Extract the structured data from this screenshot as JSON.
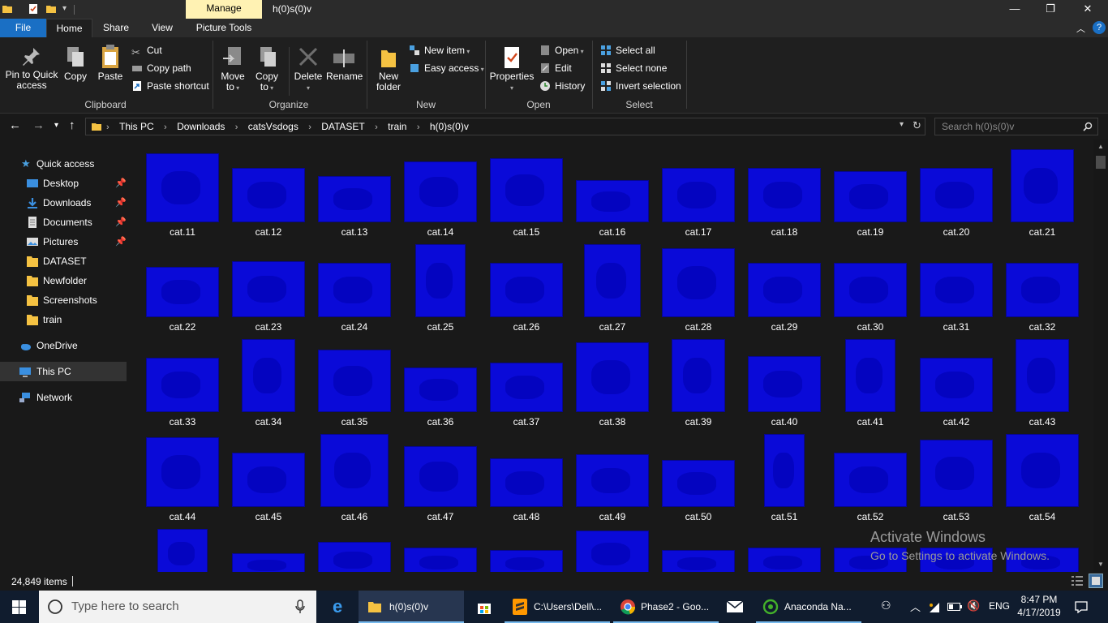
{
  "window": {
    "title": "h(0)s(0)v",
    "manage_label": "Manage",
    "minimize": "—",
    "restore": "❐",
    "close": "✕"
  },
  "ribbon_tabs": [
    "File",
    "Home",
    "Share",
    "View",
    "Picture Tools"
  ],
  "ribbon": {
    "clipboard": {
      "pin_line1": "Pin to Quick",
      "pin_line2": "access",
      "copy": "Copy",
      "paste": "Paste",
      "cut": "Cut",
      "copy_path": "Copy path",
      "paste_shortcut": "Paste shortcut",
      "label": "Clipboard"
    },
    "organize": {
      "move_to_1": "Move",
      "move_to_2": "to",
      "copy_to_1": "Copy",
      "copy_to_2": "to",
      "delete": "Delete",
      "rename": "Rename",
      "label": "Organize"
    },
    "new": {
      "new_folder_1": "New",
      "new_folder_2": "folder",
      "new_item": "New item",
      "easy_access": "Easy access",
      "label": "New"
    },
    "open": {
      "properties": "Properties",
      "open": "Open",
      "edit": "Edit",
      "history": "History",
      "label": "Open"
    },
    "select": {
      "select_all": "Select all",
      "select_none": "Select none",
      "invert_selection": "Invert selection",
      "label": "Select"
    }
  },
  "address": {
    "breadcrumbs": [
      "This PC",
      "Downloads",
      "catsVsdogs",
      "DATASET",
      "train",
      "h(0)s(0)v"
    ],
    "search_placeholder": "Search h(0)s(0)v"
  },
  "navpane": {
    "quick_access": "Quick access",
    "items": [
      "Desktop",
      "Downloads",
      "Documents",
      "Pictures",
      "DATASET",
      "Newfolder",
      "Screenshots",
      "train"
    ],
    "onedrive": "OneDrive",
    "this_pc": "This PC",
    "network": "Network"
  },
  "files": [
    "cat.11",
    "cat.12",
    "cat.13",
    "cat.14",
    "cat.15",
    "cat.16",
    "cat.17",
    "cat.18",
    "cat.19",
    "cat.20",
    "cat.21",
    "cat.22",
    "cat.23",
    "cat.24",
    "cat.25",
    "cat.26",
    "cat.27",
    "cat.28",
    "cat.29",
    "cat.30",
    "cat.31",
    "cat.32",
    "cat.33",
    "cat.34",
    "cat.35",
    "cat.36",
    "cat.37",
    "cat.38",
    "cat.39",
    "cat.40",
    "cat.41",
    "cat.42",
    "cat.43",
    "cat.44",
    "cat.45",
    "cat.46",
    "cat.47",
    "cat.48",
    "cat.49",
    "cat.50",
    "cat.51",
    "cat.52",
    "cat.53",
    "cat.54"
  ],
  "status": {
    "item_count": "24,849 items"
  },
  "watermark": {
    "line1": "Activate Windows",
    "line2": "Go to Settings to activate Windows."
  },
  "taskbar": {
    "search_placeholder": "Type here to search",
    "explorer": "h(0)s(0)v",
    "sublime": "C:\\Users\\Dell\\...",
    "chrome": "Phase2 - Goo...",
    "anaconda": "Anaconda Na...",
    "language": "ENG",
    "time": "8:47 PM",
    "date": "4/17/2019"
  },
  "colors": {
    "accent": "#1a6fc4",
    "thumbnail_blue": "#0a0ad8",
    "manage_tab": "#fff2b3",
    "taskbar": "#101c2e"
  }
}
